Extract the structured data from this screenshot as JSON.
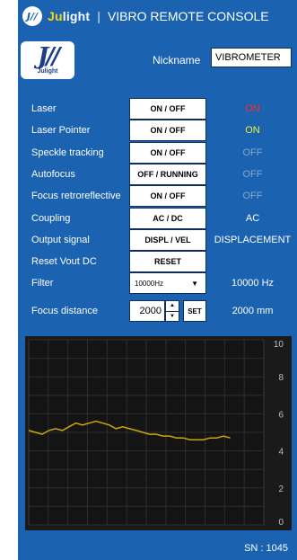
{
  "window": {
    "brand": "Julight",
    "brand_ju": "Ju",
    "brand_rest": "light",
    "separator": "|",
    "title": "VIBRO REMOTE CONSOLE",
    "logo_glyph": "J//"
  },
  "logo": {
    "mark": "J//",
    "sub": "Julight"
  },
  "nickname": {
    "label": "Nickname",
    "value": "VIBROMETER"
  },
  "colors": {
    "accent": "#1b62b0",
    "on_red": "#ff2a2a",
    "on_yellow": "#f2f22a",
    "off_gray": "#8aa6c9",
    "text": "#ffffff"
  },
  "rows": [
    {
      "label": "Laser",
      "button": "ON / OFF",
      "value": "ON",
      "value_color": "#ff2a2a"
    },
    {
      "label": "Laser Pointer",
      "button": "ON / OFF",
      "value": "ON",
      "value_color": "#f2f22a"
    },
    {
      "label": "Speckle tracking",
      "button": "ON / OFF",
      "value": "OFF",
      "value_color": "#8aa6c9"
    },
    {
      "label": "Autofocus",
      "button": "OFF / RUNNING",
      "value": "OFF",
      "value_color": "#8aa6c9"
    },
    {
      "label": "Focus retroreflective",
      "button": "ON / OFF",
      "value": "OFF",
      "value_color": "#8aa6c9"
    },
    {
      "label": "Coupling",
      "button": "AC / DC",
      "value": "AC",
      "value_color": "#ffffff"
    },
    {
      "label": "Output signal",
      "button": "DISPL / VEL",
      "value": "DISPLACEMENT",
      "value_color": "#ffffff"
    },
    {
      "label": "Reset Vout DC",
      "button": "RESET",
      "value": "",
      "value_color": "#ffffff"
    }
  ],
  "filter": {
    "label": "Filter",
    "selected": "10000Hz",
    "value": "10000 Hz"
  },
  "focus_distance": {
    "label": "Focus distance",
    "input": "2000",
    "set_label": "SET",
    "value": "2000 mm",
    "spin_up": "▲",
    "spin_down": "▼"
  },
  "icons": {
    "dropdown": "chevron-down-icon"
  },
  "chart_data": {
    "type": "line",
    "title": "",
    "xlabel": "",
    "ylabel": "",
    "ylim": [
      0,
      10
    ],
    "xlim": [
      0,
      70
    ],
    "y_ticks": [
      "0",
      "2",
      "4",
      "6",
      "8",
      "10"
    ],
    "grid": true,
    "line_color": "#c8a80a",
    "series": [
      {
        "name": "",
        "x": [
          0,
          2,
          4,
          6,
          8,
          10,
          12,
          14,
          16,
          18,
          20,
          22,
          24,
          26,
          28,
          30,
          32,
          34,
          36,
          38,
          40,
          42,
          44,
          46,
          48,
          50,
          52,
          54,
          56,
          58,
          60
        ],
        "y": [
          5.1,
          5.0,
          4.9,
          5.1,
          5.2,
          5.1,
          5.3,
          5.5,
          5.4,
          5.5,
          5.6,
          5.5,
          5.4,
          5.2,
          5.3,
          5.2,
          5.1,
          5.0,
          4.9,
          4.9,
          4.8,
          4.8,
          4.7,
          4.7,
          4.6,
          4.6,
          4.6,
          4.7,
          4.7,
          4.8,
          4.7
        ]
      }
    ]
  },
  "footer": {
    "serial": "SN : 1045"
  }
}
